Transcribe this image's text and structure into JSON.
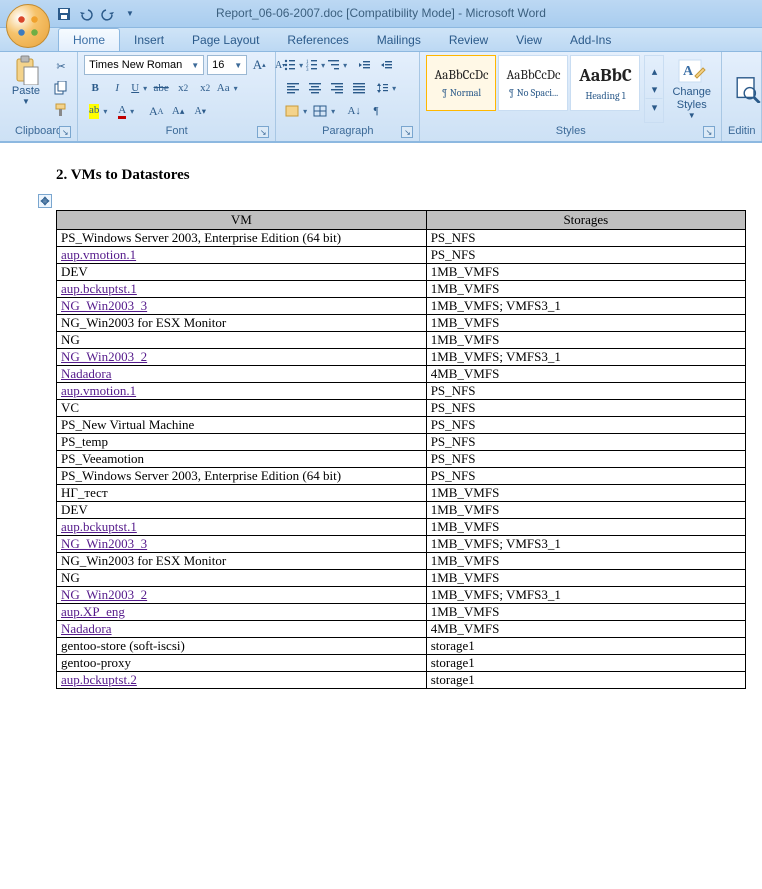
{
  "app": {
    "title": "Report_06-06-2007.doc [Compatibility Mode] - Microsoft Word"
  },
  "tabs": {
    "items": [
      "Home",
      "Insert",
      "Page Layout",
      "References",
      "Mailings",
      "Review",
      "View",
      "Add-Ins"
    ],
    "active": 0
  },
  "ribbon": {
    "clipboard": {
      "paste": "Paste",
      "label": "Clipboard"
    },
    "font": {
      "name": "Times New Roman",
      "size": "16",
      "label": "Font"
    },
    "paragraph": {
      "label": "Paragraph"
    },
    "styles": {
      "label": "Styles",
      "items": [
        {
          "preview": "AaBbCcDc",
          "name": "¶ Normal"
        },
        {
          "preview": "AaBbCcDc",
          "name": "¶ No Spaci..."
        },
        {
          "preview": "AaBbC",
          "name": "Heading 1"
        }
      ],
      "change": "Change Styles"
    },
    "editing": {
      "label": "Editin"
    }
  },
  "document": {
    "heading": "2. VMs to Datastores",
    "columns": [
      "VM",
      "Storages"
    ],
    "rows": [
      {
        "vm": "PS_Windows Server 2003, Enterprise Edition (64 bit)",
        "st": "PS_NFS",
        "link": false
      },
      {
        "vm": "aup.vmotion.1",
        "st": "PS_NFS",
        "link": true
      },
      {
        "vm": "DEV",
        "st": "1MB_VMFS",
        "link": false
      },
      {
        "vm": "aup.bckuptst.1",
        "st": "1MB_VMFS",
        "link": true
      },
      {
        "vm": "NG_Win2003_3",
        "st": "1MB_VMFS; VMFS3_1",
        "link": true
      },
      {
        "vm": "NG_Win2003 for ESX Monitor",
        "st": "1MB_VMFS",
        "link": false
      },
      {
        "vm": "NG",
        "st": "1MB_VMFS",
        "link": false
      },
      {
        "vm": "NG_Win2003_2",
        "st": "1MB_VMFS; VMFS3_1",
        "link": true
      },
      {
        "vm": "Nadadora",
        "st": "4MB_VMFS",
        "link": true
      },
      {
        "vm": "aup.vmotion.1",
        "st": "PS_NFS",
        "link": true
      },
      {
        "vm": "VC",
        "st": "PS_NFS",
        "link": false
      },
      {
        "vm": "PS_New Virtual Machine",
        "st": "PS_NFS",
        "link": false
      },
      {
        "vm": "PS_temp",
        "st": "PS_NFS",
        "link": false
      },
      {
        "vm": "PS_Veeamotion",
        "st": "PS_NFS",
        "link": false
      },
      {
        "vm": "PS_Windows Server 2003, Enterprise Edition (64 bit)",
        "st": "PS_NFS",
        "link": false
      },
      {
        "vm": "НГ_тест",
        "st": "1MB_VMFS",
        "link": false
      },
      {
        "vm": "DEV",
        "st": "1MB_VMFS",
        "link": false
      },
      {
        "vm": "aup.bckuptst.1",
        "st": "1MB_VMFS",
        "link": true
      },
      {
        "vm": "NG_Win2003_3",
        "st": "1MB_VMFS; VMFS3_1",
        "link": true
      },
      {
        "vm": "NG_Win2003 for ESX Monitor",
        "st": "1MB_VMFS",
        "link": false
      },
      {
        "vm": "NG",
        "st": "1MB_VMFS",
        "link": false
      },
      {
        "vm": "NG_Win2003_2",
        "st": "1MB_VMFS; VMFS3_1",
        "link": true
      },
      {
        "vm": "aup.XP_eng",
        "st": "1MB_VMFS",
        "link": true
      },
      {
        "vm": "Nadadora",
        "st": "4MB_VMFS",
        "link": true
      },
      {
        "vm": "gentoo-store (soft-iscsi)",
        "st": "storage1",
        "link": false
      },
      {
        "vm": "gentoo-proxy",
        "st": "storage1",
        "link": false
      },
      {
        "vm": "aup.bckuptst.2",
        "st": "storage1",
        "link": true
      }
    ]
  }
}
